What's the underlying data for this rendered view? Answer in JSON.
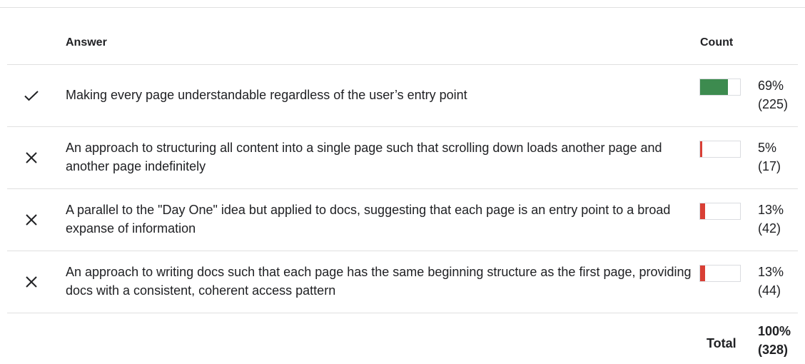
{
  "table": {
    "answer_header": "Answer",
    "count_header": "Count"
  },
  "rows": [
    {
      "correct": true,
      "text": "Making every page understandable regardless of the user’s entry point",
      "percent": "69%",
      "count": "(225)",
      "fraction": 0.69,
      "bar_color": "#3d8b4f"
    },
    {
      "correct": false,
      "text": "An approach to structuring all content into a single page such that scrolling down loads another page and another page indefinitely",
      "percent": "5%",
      "count": "(17)",
      "fraction": 0.05,
      "bar_color": "#d93f35"
    },
    {
      "correct": false,
      "text": "A parallel to the \"Day One\" idea but applied to docs, suggesting that each page is an entry point to a broad expanse of information",
      "percent": "13%",
      "count": "(42)",
      "fraction": 0.13,
      "bar_color": "#d93f35"
    },
    {
      "correct": false,
      "text": "An approach to writing docs such that each page has the same beginning structure as the first page, providing docs with a consistent, coherent access pattern",
      "percent": "13%",
      "count": "(44)",
      "fraction": 0.13,
      "bar_color": "#d93f35"
    }
  ],
  "icons": {
    "correct": "check-icon",
    "incorrect": "close-icon"
  },
  "total": {
    "label": "Total",
    "percent": "100%",
    "count": "(328)"
  }
}
